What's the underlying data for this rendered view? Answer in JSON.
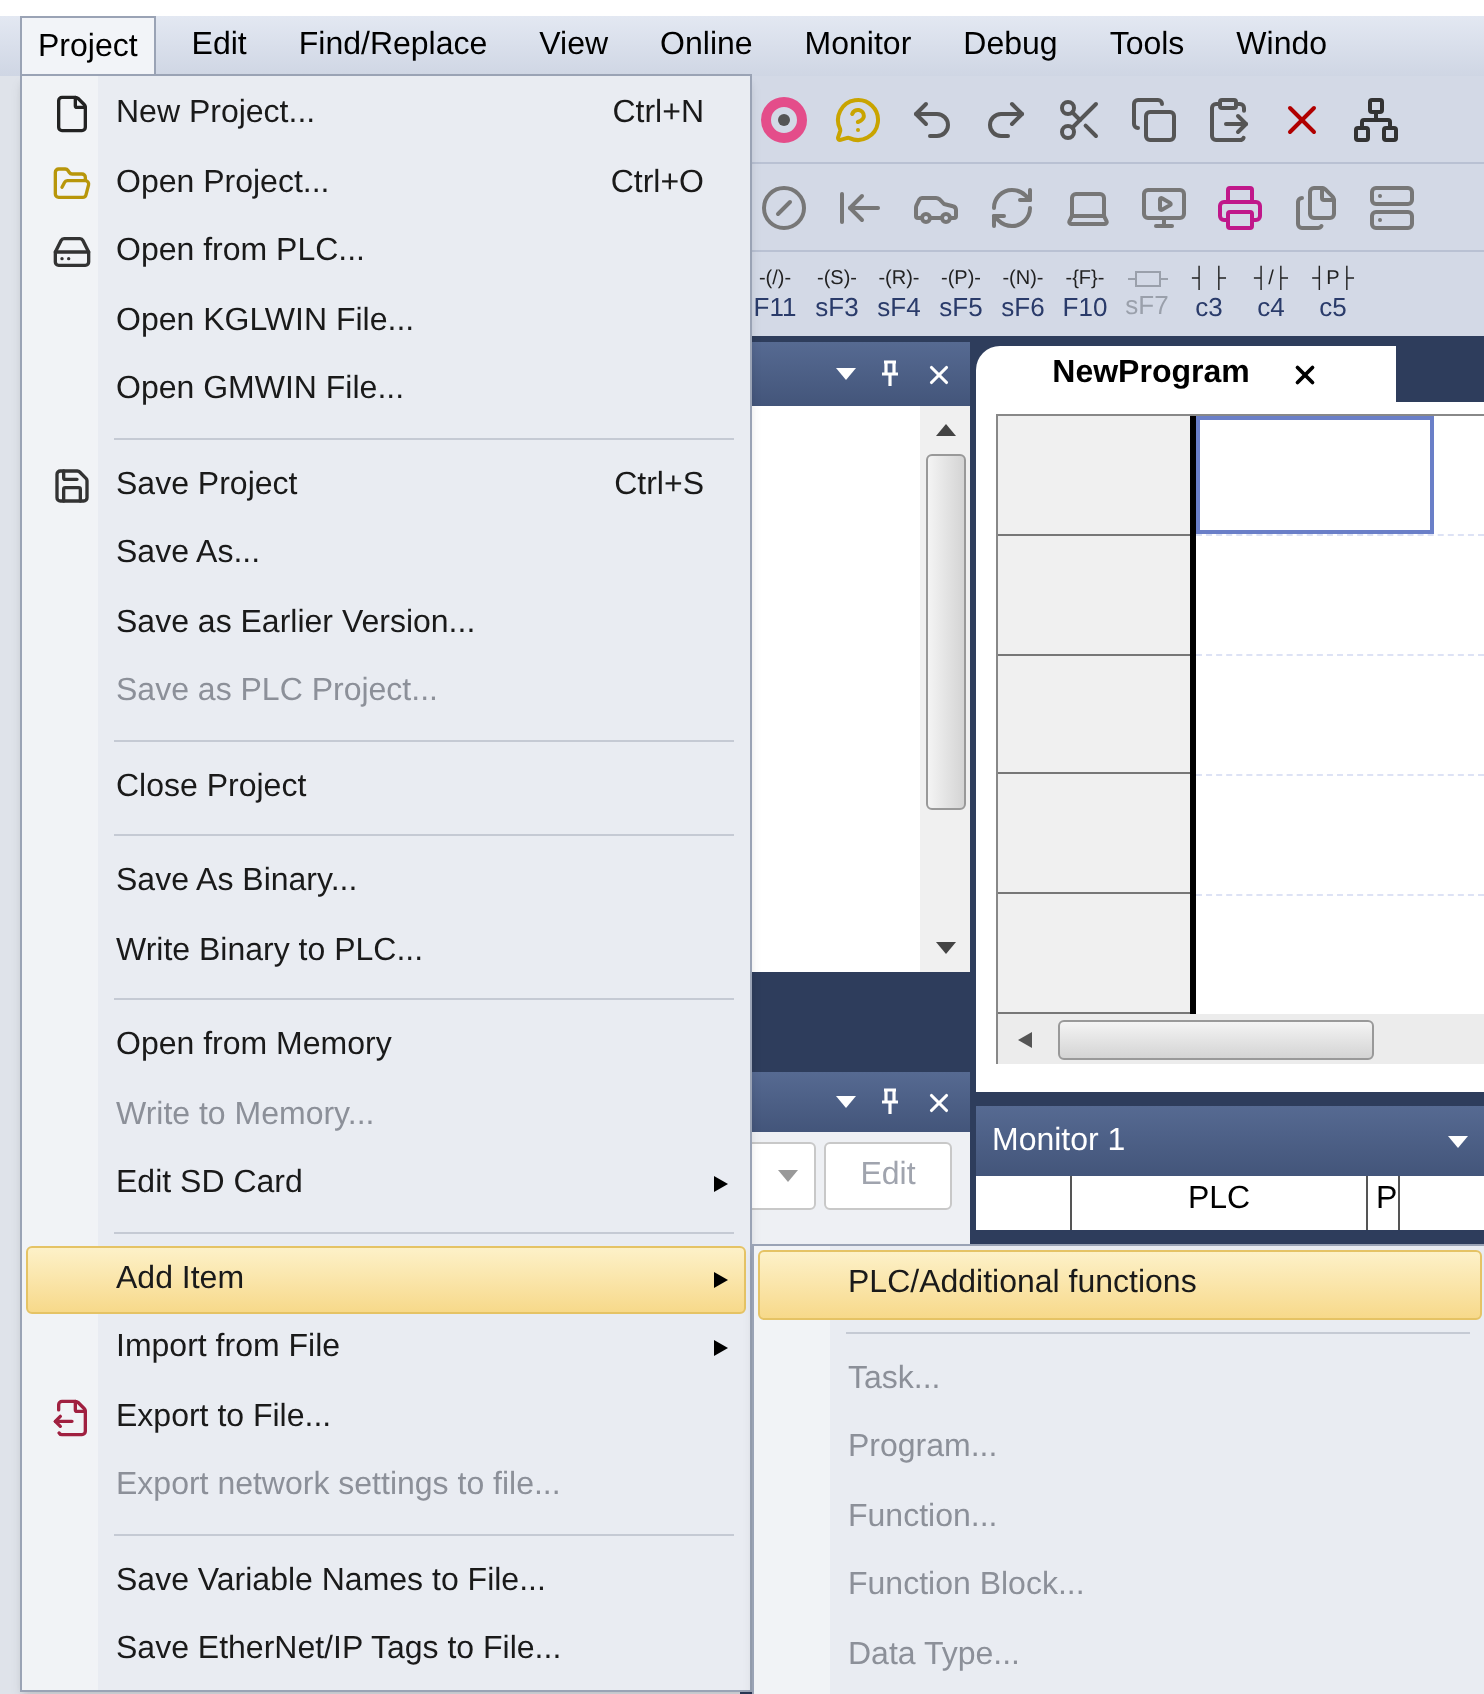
{
  "menu_bar": [
    {
      "label": "Project",
      "selected": true
    },
    {
      "label": "Edit",
      "selected": false
    },
    {
      "label": "Find/Replace",
      "selected": false
    },
    {
      "label": "View",
      "selected": false
    },
    {
      "label": "Online",
      "selected": false
    },
    {
      "label": "Monitor",
      "selected": false
    },
    {
      "label": "Debug",
      "selected": false
    },
    {
      "label": "Tools",
      "selected": false
    },
    {
      "label": "Windo",
      "selected": false
    }
  ],
  "ladder_toolbar": [
    {
      "symbol": "-(/)-",
      "key": "F11",
      "disabled": false
    },
    {
      "symbol": "-(S)-",
      "key": "sF3",
      "disabled": false
    },
    {
      "symbol": "-(R)-",
      "key": "sF4",
      "disabled": false
    },
    {
      "symbol": "-(P)-",
      "key": "sF5",
      "disabled": false
    },
    {
      "symbol": "-(N)-",
      "key": "sF6",
      "disabled": false
    },
    {
      "symbol": "-{F}-",
      "key": "F10",
      "disabled": false
    },
    {
      "key": "sF7",
      "disabled": true
    },
    {
      "symbol": "┤ ├",
      "key": "c3",
      "disabled": false
    },
    {
      "symbol": "┤/├",
      "key": "c4",
      "disabled": false
    },
    {
      "symbol": "┤P├",
      "key": "c5",
      "disabled": false
    }
  ],
  "editor": {
    "tab": "NewProgram"
  },
  "variable_panel": {
    "edit_button": {
      "label": "Edit",
      "disabled": true
    }
  },
  "monitor": {
    "title": "Monitor 1",
    "columns": [
      "PLC",
      "P"
    ]
  },
  "project_menu": [
    {
      "kind": "item",
      "label": "New Project...",
      "shortcut": "Ctrl+N",
      "disabled": false,
      "selected": false,
      "submenu": false
    },
    {
      "kind": "item",
      "label": "Open Project...",
      "shortcut": "Ctrl+O",
      "disabled": false,
      "selected": false,
      "submenu": false
    },
    {
      "kind": "item",
      "label": "Open from PLC...",
      "disabled": false,
      "selected": false,
      "submenu": false
    },
    {
      "kind": "item",
      "label": "Open KGLWIN File...",
      "disabled": false,
      "selected": false,
      "submenu": false
    },
    {
      "kind": "item",
      "label": "Open GMWIN File...",
      "disabled": false,
      "selected": false,
      "submenu": false
    },
    {
      "kind": "separator"
    },
    {
      "kind": "item",
      "label": "Save Project",
      "shortcut": "Ctrl+S",
      "disabled": false,
      "selected": false,
      "submenu": false
    },
    {
      "kind": "item",
      "label": "Save As...",
      "disabled": false,
      "selected": false,
      "submenu": false
    },
    {
      "kind": "item",
      "label": "Save as Earlier Version...",
      "disabled": false,
      "selected": false,
      "submenu": false
    },
    {
      "kind": "item",
      "label": "Save as PLC Project...",
      "disabled": true,
      "selected": false,
      "submenu": false
    },
    {
      "kind": "separator"
    },
    {
      "kind": "item",
      "label": "Close Project",
      "disabled": false,
      "selected": false,
      "submenu": false
    },
    {
      "kind": "separator"
    },
    {
      "kind": "item",
      "label": "Save As Binary...",
      "disabled": false,
      "selected": false,
      "submenu": false
    },
    {
      "kind": "item",
      "label": "Write Binary to PLC...",
      "disabled": false,
      "selected": false,
      "submenu": false
    },
    {
      "kind": "separator"
    },
    {
      "kind": "item",
      "label": "Open from Memory",
      "disabled": false,
      "selected": false,
      "submenu": false
    },
    {
      "kind": "item",
      "label": "Write to Memory...",
      "disabled": true,
      "selected": false,
      "submenu": false
    },
    {
      "kind": "item",
      "label": "Edit SD Card",
      "disabled": false,
      "selected": false,
      "submenu": true
    },
    {
      "kind": "separator"
    },
    {
      "kind": "item",
      "label": "Add Item",
      "disabled": false,
      "selected": true,
      "submenu": true
    },
    {
      "kind": "item",
      "label": "Import from File",
      "disabled": false,
      "selected": false,
      "submenu": true
    },
    {
      "kind": "item",
      "label": "Export to File...",
      "disabled": false,
      "selected": false,
      "submenu": false
    },
    {
      "kind": "item",
      "label": "Export network settings to file...",
      "disabled": true,
      "selected": false,
      "submenu": false
    },
    {
      "kind": "separator"
    },
    {
      "kind": "item",
      "label": "Save Variable Names to File...",
      "disabled": false,
      "selected": false,
      "submenu": false
    },
    {
      "kind": "item",
      "label": "Save EtherNet/IP Tags to File...",
      "disabled": false,
      "selected": false,
      "submenu": false
    }
  ],
  "add_item_submenu": [
    {
      "kind": "item",
      "label": "PLC/Additional functions",
      "disabled": false,
      "selected": true
    },
    {
      "kind": "separator"
    },
    {
      "kind": "item",
      "label": "Task...",
      "disabled": true,
      "selected": false
    },
    {
      "kind": "item",
      "label": "Program...",
      "disabled": true,
      "selected": false
    },
    {
      "kind": "item",
      "label": "Function...",
      "disabled": true,
      "selected": false
    },
    {
      "kind": "item",
      "label": "Function Block...",
      "disabled": true,
      "selected": false
    },
    {
      "kind": "item",
      "label": "Data Type...",
      "disabled": true,
      "selected": false
    }
  ]
}
